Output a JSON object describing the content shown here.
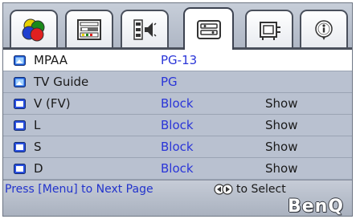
{
  "tabs": [
    {
      "name": "picture-tab",
      "icon": "color-circles-icon",
      "active": false
    },
    {
      "name": "display-tab",
      "icon": "screen-settings-icon",
      "active": false
    },
    {
      "name": "settings-tab",
      "icon": "speaker-setup-icon",
      "active": false
    },
    {
      "name": "advanced-tab",
      "icon": "toolbox-icon",
      "active": true
    },
    {
      "name": "source-tab",
      "icon": "input-source-icon",
      "active": false
    },
    {
      "name": "info-tab",
      "icon": "info-icon",
      "active": false
    }
  ],
  "rows": [
    {
      "label": "MPAA",
      "value": "PG-13",
      "extra": "",
      "icon": "tv-picture-icon",
      "highlighted": true
    },
    {
      "label": "TV Guide",
      "value": "PG",
      "extra": "",
      "icon": "tv-picture-icon",
      "highlighted": false
    },
    {
      "label": "V (FV)",
      "value": "Block",
      "extra": "Show",
      "icon": "tv-blue-icon",
      "highlighted": false
    },
    {
      "label": "L",
      "value": "Block",
      "extra": "Show",
      "icon": "tv-blue-icon",
      "highlighted": false
    },
    {
      "label": "S",
      "value": "Block",
      "extra": "Show",
      "icon": "tv-blue-icon",
      "highlighted": false
    },
    {
      "label": "D",
      "value": "Block",
      "extra": "Show",
      "icon": "tv-blue-icon",
      "highlighted": false
    }
  ],
  "footer": {
    "next_page_hint": "Press [Menu] to Next Page",
    "select_hint": "to Select",
    "select_icon": "left-right-arrows-icon",
    "brand": "BenQ"
  },
  "colors": {
    "panel": "#b9c1d0",
    "value_text": "#2a35d8",
    "hint_text": "#2233cc"
  }
}
